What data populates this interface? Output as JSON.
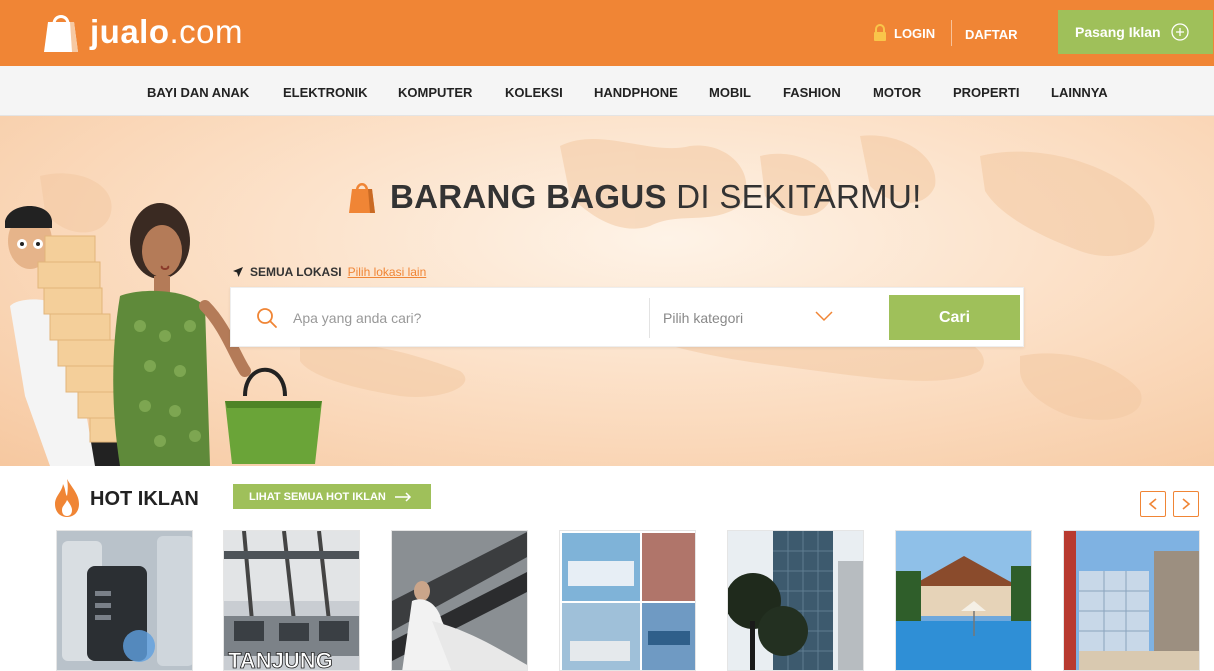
{
  "header": {
    "logo_text_bold": "jualo",
    "logo_text_rest": ".com",
    "login_label": "LOGIN",
    "register_label": "DAFTAR",
    "post_ad_label": "Pasang Iklan",
    "brand_color": "#f08535",
    "accent_color": "#9fc05a"
  },
  "categories": [
    "BAYI DAN ANAK",
    "ELEKTRONIK",
    "KOMPUTER",
    "KOLEKSI",
    "HANDPHONE",
    "MOBIL",
    "FASHION",
    "MOTOR",
    "PROPERTI",
    "LAINNYA"
  ],
  "hero": {
    "title_bold": "BARANG BAGUS",
    "title_rest": "DI SEKITARMU!",
    "location_label": "SEMUA LOKASI",
    "location_link": "Pilih lokasi lain",
    "search_placeholder": "Apa yang anda cari?",
    "category_placeholder": "Pilih kategori",
    "search_button": "Cari"
  },
  "hot": {
    "title": "HOT IKLAN",
    "see_all_label": "LIHAT SEMUA HOT IKLAN",
    "items": [
      {
        "image": "phone-accessory-photo"
      },
      {
        "image": "port-cranes-photo",
        "overlay_text": "TANJUNG"
      },
      {
        "image": "wedding-couple-photo"
      },
      {
        "image": "event-collage-photo"
      },
      {
        "image": "office-tower-photo"
      },
      {
        "image": "villa-pool-photo"
      },
      {
        "image": "building-courtyard-photo"
      }
    ]
  }
}
